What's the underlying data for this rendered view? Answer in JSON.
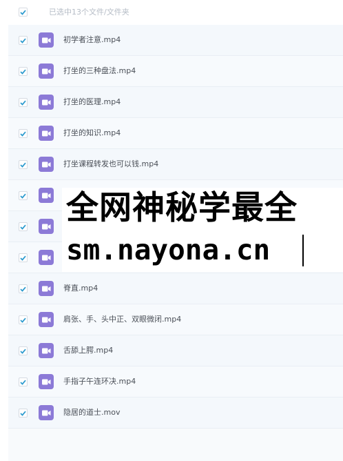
{
  "header": {
    "selection_text": "已选中13个文件/文件夹",
    "checked": true
  },
  "files": [
    {
      "name": "初学者注意.mp4",
      "checked": true,
      "icon": "video-file-icon"
    },
    {
      "name": "打坐的三种盘法.mp4",
      "checked": true,
      "icon": "video-file-icon"
    },
    {
      "name": "打坐的医理.mp4",
      "checked": true,
      "icon": "video-file-icon"
    },
    {
      "name": "打坐的知识.mp4",
      "checked": true,
      "icon": "video-file-icon"
    },
    {
      "name": "打坐课程转发也可以钱.mp4",
      "checked": true,
      "icon": "video-file-icon"
    },
    {
      "name": "",
      "checked": true,
      "icon": "video-file-icon"
    },
    {
      "name": "",
      "checked": true,
      "icon": "video-file-icon"
    },
    {
      "name": "",
      "checked": true,
      "icon": "video-file-icon"
    },
    {
      "name": "脊直.mp4",
      "checked": true,
      "icon": "video-file-icon"
    },
    {
      "name": "肩张、手、头中正、双眼微闭.mp4",
      "checked": true,
      "icon": "video-file-icon"
    },
    {
      "name": "舌舔上腭.mp4",
      "checked": true,
      "icon": "video-file-icon"
    },
    {
      "name": "手指子午连环决.mp4",
      "checked": true,
      "icon": "video-file-icon"
    },
    {
      "name": "隐居的道士.mov",
      "checked": true,
      "icon": "video-file-icon"
    }
  ],
  "watermark": {
    "line1": "全网神秘学最全",
    "line2": "sm.nayona.cn"
  },
  "colors": {
    "check_accent": "#2f9ccf",
    "file_icon_bg": "#8c7ad7",
    "row_bg": "#f4f8fc",
    "header_text": "#b5bcc6",
    "file_text": "#4a4f57"
  }
}
